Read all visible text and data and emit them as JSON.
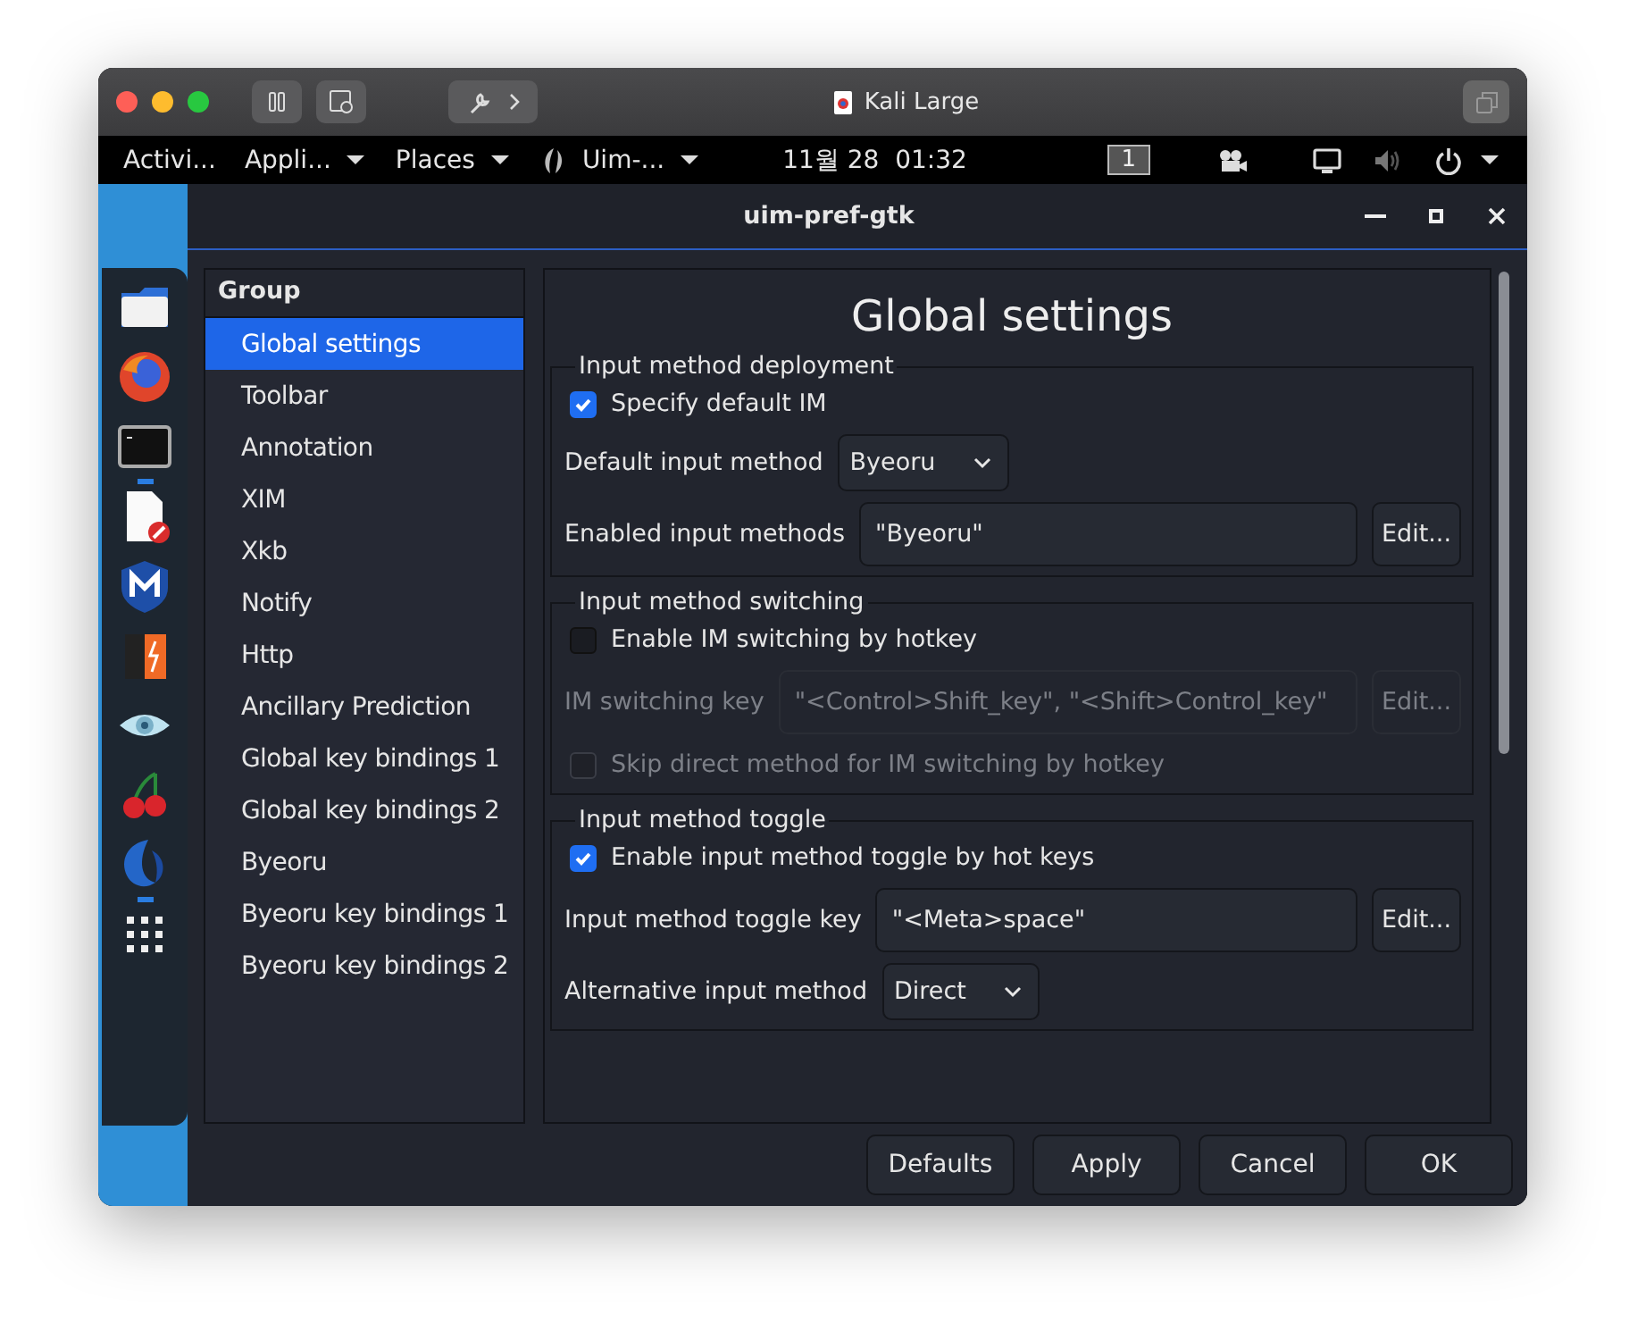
{
  "vm_window": {
    "title": "Kali Large"
  },
  "top_bar": {
    "activities": "Activi...",
    "applications": "Appli...",
    "places": "Places",
    "app_menu": "Uim-...",
    "clock": "11월 28  01:32",
    "workspace": "1"
  },
  "dock": {
    "items": [
      {
        "kind": "folder",
        "running": false
      },
      {
        "kind": "browser",
        "running": false
      },
      {
        "kind": "terminal",
        "running": true
      },
      {
        "kind": "document",
        "running": false
      },
      {
        "kind": "shield",
        "running": false
      },
      {
        "kind": "box",
        "running": false
      },
      {
        "kind": "eye",
        "running": false
      },
      {
        "kind": "cherry",
        "running": false
      },
      {
        "kind": "swirl",
        "running": true
      },
      {
        "kind": "grid",
        "running": false
      }
    ]
  },
  "app_window": {
    "title": "uim-pref-gtk"
  },
  "sidebar": {
    "header": "Group",
    "items": [
      {
        "label": "Global settings",
        "selected": true
      },
      {
        "label": "Toolbar",
        "selected": false
      },
      {
        "label": "Annotation",
        "selected": false
      },
      {
        "label": "XIM",
        "selected": false
      },
      {
        "label": "Xkb",
        "selected": false
      },
      {
        "label": "Notify",
        "selected": false
      },
      {
        "label": "Http",
        "selected": false
      },
      {
        "label": "Ancillary Prediction",
        "selected": false
      },
      {
        "label": "Global key bindings 1",
        "selected": false
      },
      {
        "label": "Global key bindings 2",
        "selected": false
      },
      {
        "label": "Byeoru",
        "selected": false
      },
      {
        "label": "Byeoru key bindings 1",
        "selected": false
      },
      {
        "label": "Byeoru key bindings 2",
        "selected": false
      }
    ]
  },
  "page": {
    "title": "Global settings",
    "sections": [
      {
        "title": "Input method deployment",
        "rows": [
          {
            "kind": "checkbox",
            "label": "Specify default IM",
            "checked": true,
            "disabled": false
          },
          {
            "kind": "combo",
            "label": "Default input method",
            "value": "Byeoru"
          },
          {
            "kind": "entry",
            "label": "Enabled input methods",
            "value": "\"Byeoru\"",
            "button": "Edit...",
            "disabled": false
          }
        ]
      },
      {
        "title": "Input method switching",
        "rows": [
          {
            "kind": "checkbox",
            "label": "Enable IM switching by hotkey",
            "checked": false,
            "disabled": false
          },
          {
            "kind": "entry",
            "label": "IM switching key",
            "value": "\"<Control>Shift_key\", \"<Shift>Control_key\"",
            "button": "Edit...",
            "disabled": true
          },
          {
            "kind": "checkbox",
            "label": "Skip direct method for IM switching by hotkey",
            "checked": false,
            "disabled": true
          }
        ]
      },
      {
        "title": "Input method toggle",
        "rows": [
          {
            "kind": "checkbox",
            "label": "Enable input method toggle by hot keys",
            "checked": true,
            "disabled": false
          },
          {
            "kind": "entry",
            "label": "Input method toggle key",
            "value": "\"<Meta>space\"",
            "button": "Edit...",
            "disabled": false
          },
          {
            "kind": "combo",
            "label": "Alternative input method",
            "value": "Direct"
          }
        ]
      }
    ]
  },
  "buttons": [
    "Defaults",
    "Apply",
    "Cancel",
    "OK"
  ]
}
